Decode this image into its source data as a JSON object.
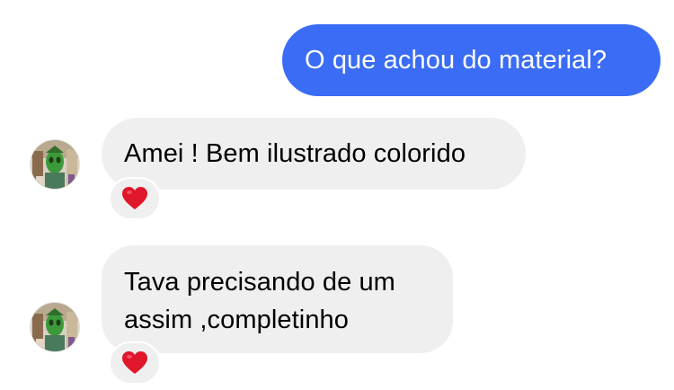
{
  "conversation": {
    "messages": [
      {
        "direction": "outgoing",
        "text": "O que achou do material?"
      },
      {
        "direction": "incoming",
        "text": "Amei ! Bem ilustrado colorido",
        "reaction": "heart-icon"
      },
      {
        "direction": "incoming",
        "text": "Tava precisando de um assim ,completinho",
        "reaction": "heart-icon"
      }
    ]
  },
  "colors": {
    "outgoing_bubble": "#3a6cf6",
    "incoming_bubble": "#efefef",
    "reaction_heart": "#e0162b"
  }
}
